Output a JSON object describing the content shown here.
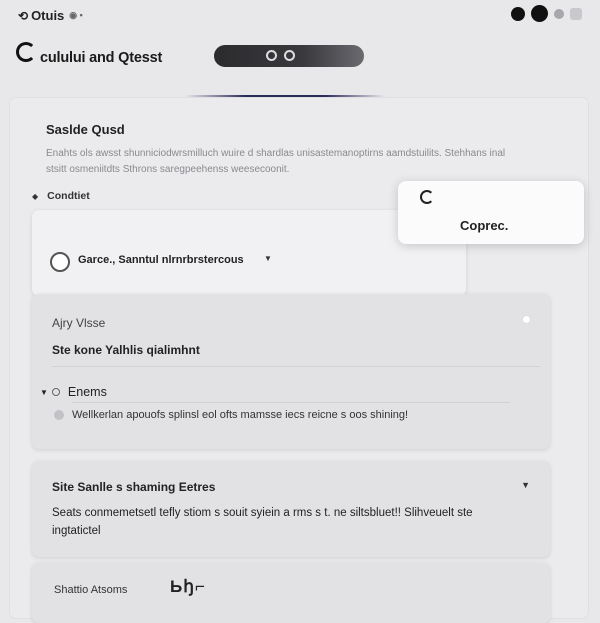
{
  "topbar": {
    "brand_label": "Otuis",
    "brand_suffix": "◉ •"
  },
  "header": {
    "app_title": "culului and Qtesst"
  },
  "section": {
    "title": "Saslde Qusd",
    "description": "Enahts ols awsst shunniciodwrsmilluch wuire d shardlas unisastemanoptirns aamdstuilits. Stehhans inal stsitt osmeniitdts Sthrons saregpeehenss weesecoonit."
  },
  "condition": {
    "label": "Condtiet"
  },
  "card1": {
    "text": "Garce., Sanntul nlrnrbrstercous"
  },
  "popover": {
    "label": "Coprec."
  },
  "card2": {
    "field_label": "Ajry Vlsse",
    "field_value": "Ste kone Yalhlis qialimhnt",
    "option_label": "Enems",
    "message": "Wellkerlan apouofs splinsl eol ofts mamsse iecs reicne s oos shining!"
  },
  "card3": {
    "heading": "Site Sanlle s shaming Eetres",
    "body": "Seats conmemetsetl tefly stiom s souit syiein a rms s t. ne siltsbluet!! Slihveuelt ste ingtatictel"
  },
  "card4": {
    "label": "Shattio Atsoms",
    "glyphs": "Ьꜧ⌐"
  },
  "colors": {
    "page_bg": "#e8e8ea",
    "card_bg": "#e2e2e4",
    "popover_bg": "#fbfbfc",
    "accent_line": "#2c2c5a",
    "search_pill": "#2b2b2e"
  },
  "icons": {
    "brand": "refresh-icon",
    "tray": [
      "apple-icon",
      "moon-icon",
      "status-dot-icon",
      "window-icon"
    ],
    "logo": "ring-icon",
    "search": [
      "search-icon",
      "settings-icon"
    ],
    "card1": "circle-icon",
    "popover": "refresh-icon"
  }
}
